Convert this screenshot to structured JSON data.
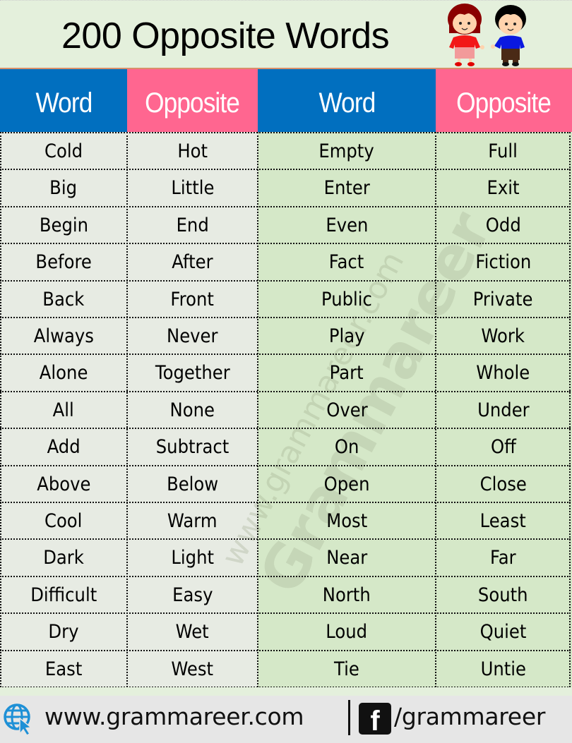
{
  "title": "200 Opposite Words",
  "header": {
    "columns": [
      "Word",
      "Opposite",
      "Word",
      "Opposite"
    ]
  },
  "colors": {
    "word_header": "#016fbf",
    "opposite_header": "#ff6690",
    "left_bg": "#e7ebe3",
    "right_bg": "#d5e8c8",
    "title_bg": "#e4f0dc"
  },
  "rows": [
    [
      "Cold",
      "Hot",
      "Empty",
      "Full"
    ],
    [
      "Big",
      "Little",
      "Enter",
      "Exit"
    ],
    [
      "Begin",
      "End",
      "Even",
      "Odd"
    ],
    [
      "Before",
      "After",
      "Fact",
      "Fiction"
    ],
    [
      "Back",
      "Front",
      "Public",
      "Private"
    ],
    [
      "Always",
      "Never",
      "Play",
      "Work"
    ],
    [
      "Alone",
      "Together",
      "Part",
      "Whole"
    ],
    [
      "All",
      "None",
      "Over",
      "Under"
    ],
    [
      "Add",
      "Subtract",
      "On",
      "Off"
    ],
    [
      "Above",
      "Below",
      "Open",
      "Close"
    ],
    [
      "Cool",
      "Warm",
      "Most",
      "Least"
    ],
    [
      "Dark",
      "Light",
      "Near",
      "Far"
    ],
    [
      "Difficult",
      "Easy",
      "North",
      "South"
    ],
    [
      "Dry",
      "Wet",
      "Loud",
      "Quiet"
    ],
    [
      "East",
      "West",
      "Tie",
      "Untie"
    ]
  ],
  "watermark": {
    "url": "www.grammareer.com",
    "brand": "Grammareer"
  },
  "footer": {
    "website_icon": "globe-cursor-icon",
    "website": "www.grammareer.com",
    "social_icon": "facebook-icon",
    "social_glyph": "f",
    "social_handle": "/grammareer"
  }
}
